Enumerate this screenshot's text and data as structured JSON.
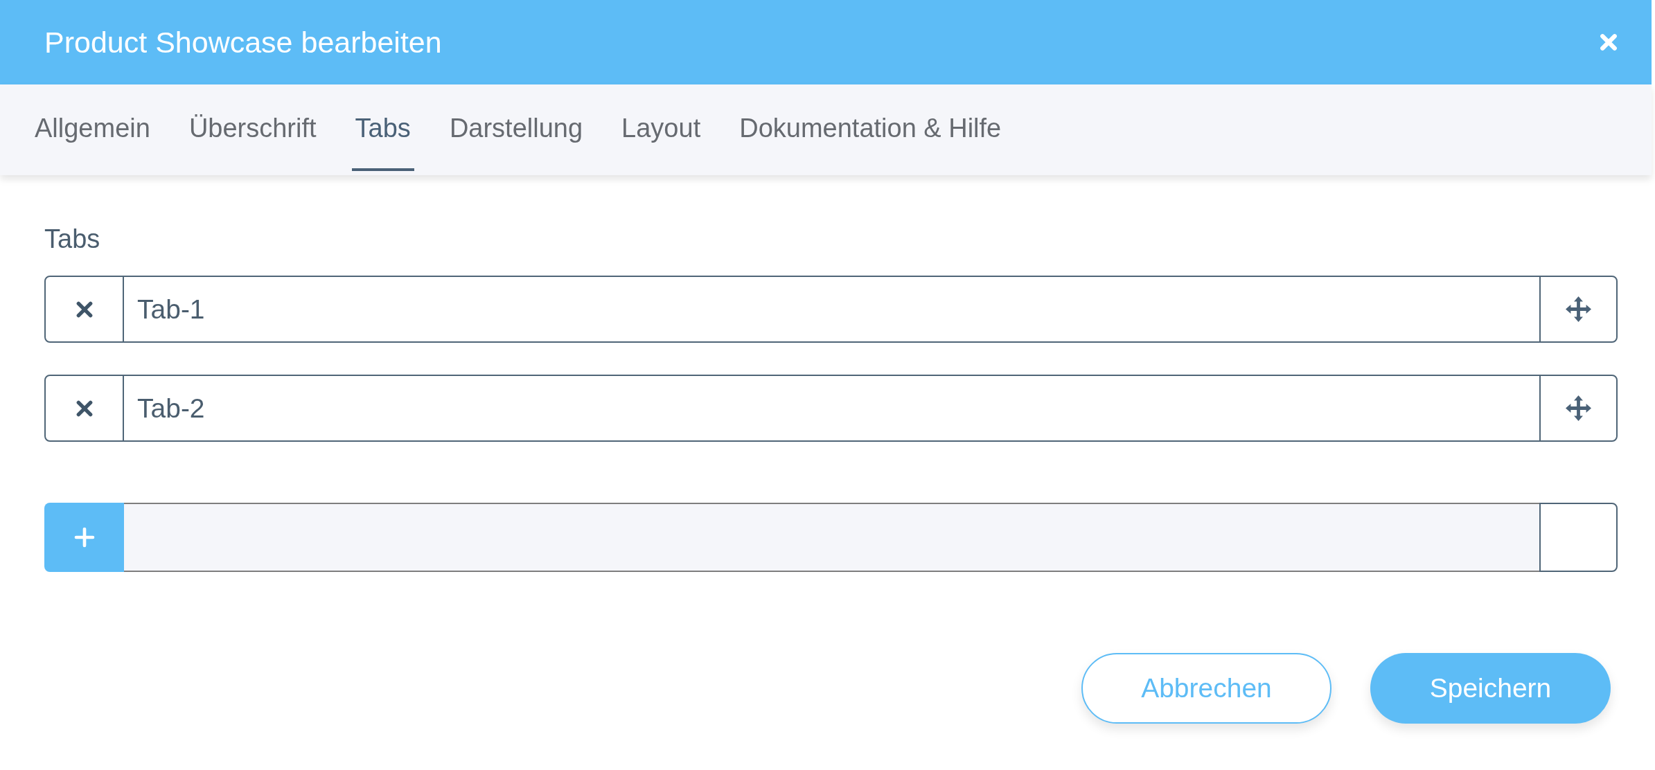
{
  "dialog": {
    "title": "Product Showcase bearbeiten"
  },
  "tabs": [
    {
      "label": "Allgemein",
      "selected": false
    },
    {
      "label": "Überschrift",
      "selected": false
    },
    {
      "label": "Tabs",
      "selected": true
    },
    {
      "label": "Darstellung",
      "selected": false
    },
    {
      "label": "Layout",
      "selected": false
    },
    {
      "label": "Dokumentation & Hilfe",
      "selected": false
    }
  ],
  "section": {
    "label": "Tabs"
  },
  "entries": [
    {
      "value": "Tab-1"
    },
    {
      "value": "Tab-2"
    }
  ],
  "buttons": [
    {
      "label": "Abbrechen",
      "kind": "secondary"
    },
    {
      "label": "Speichern",
      "kind": "primary"
    }
  ]
}
